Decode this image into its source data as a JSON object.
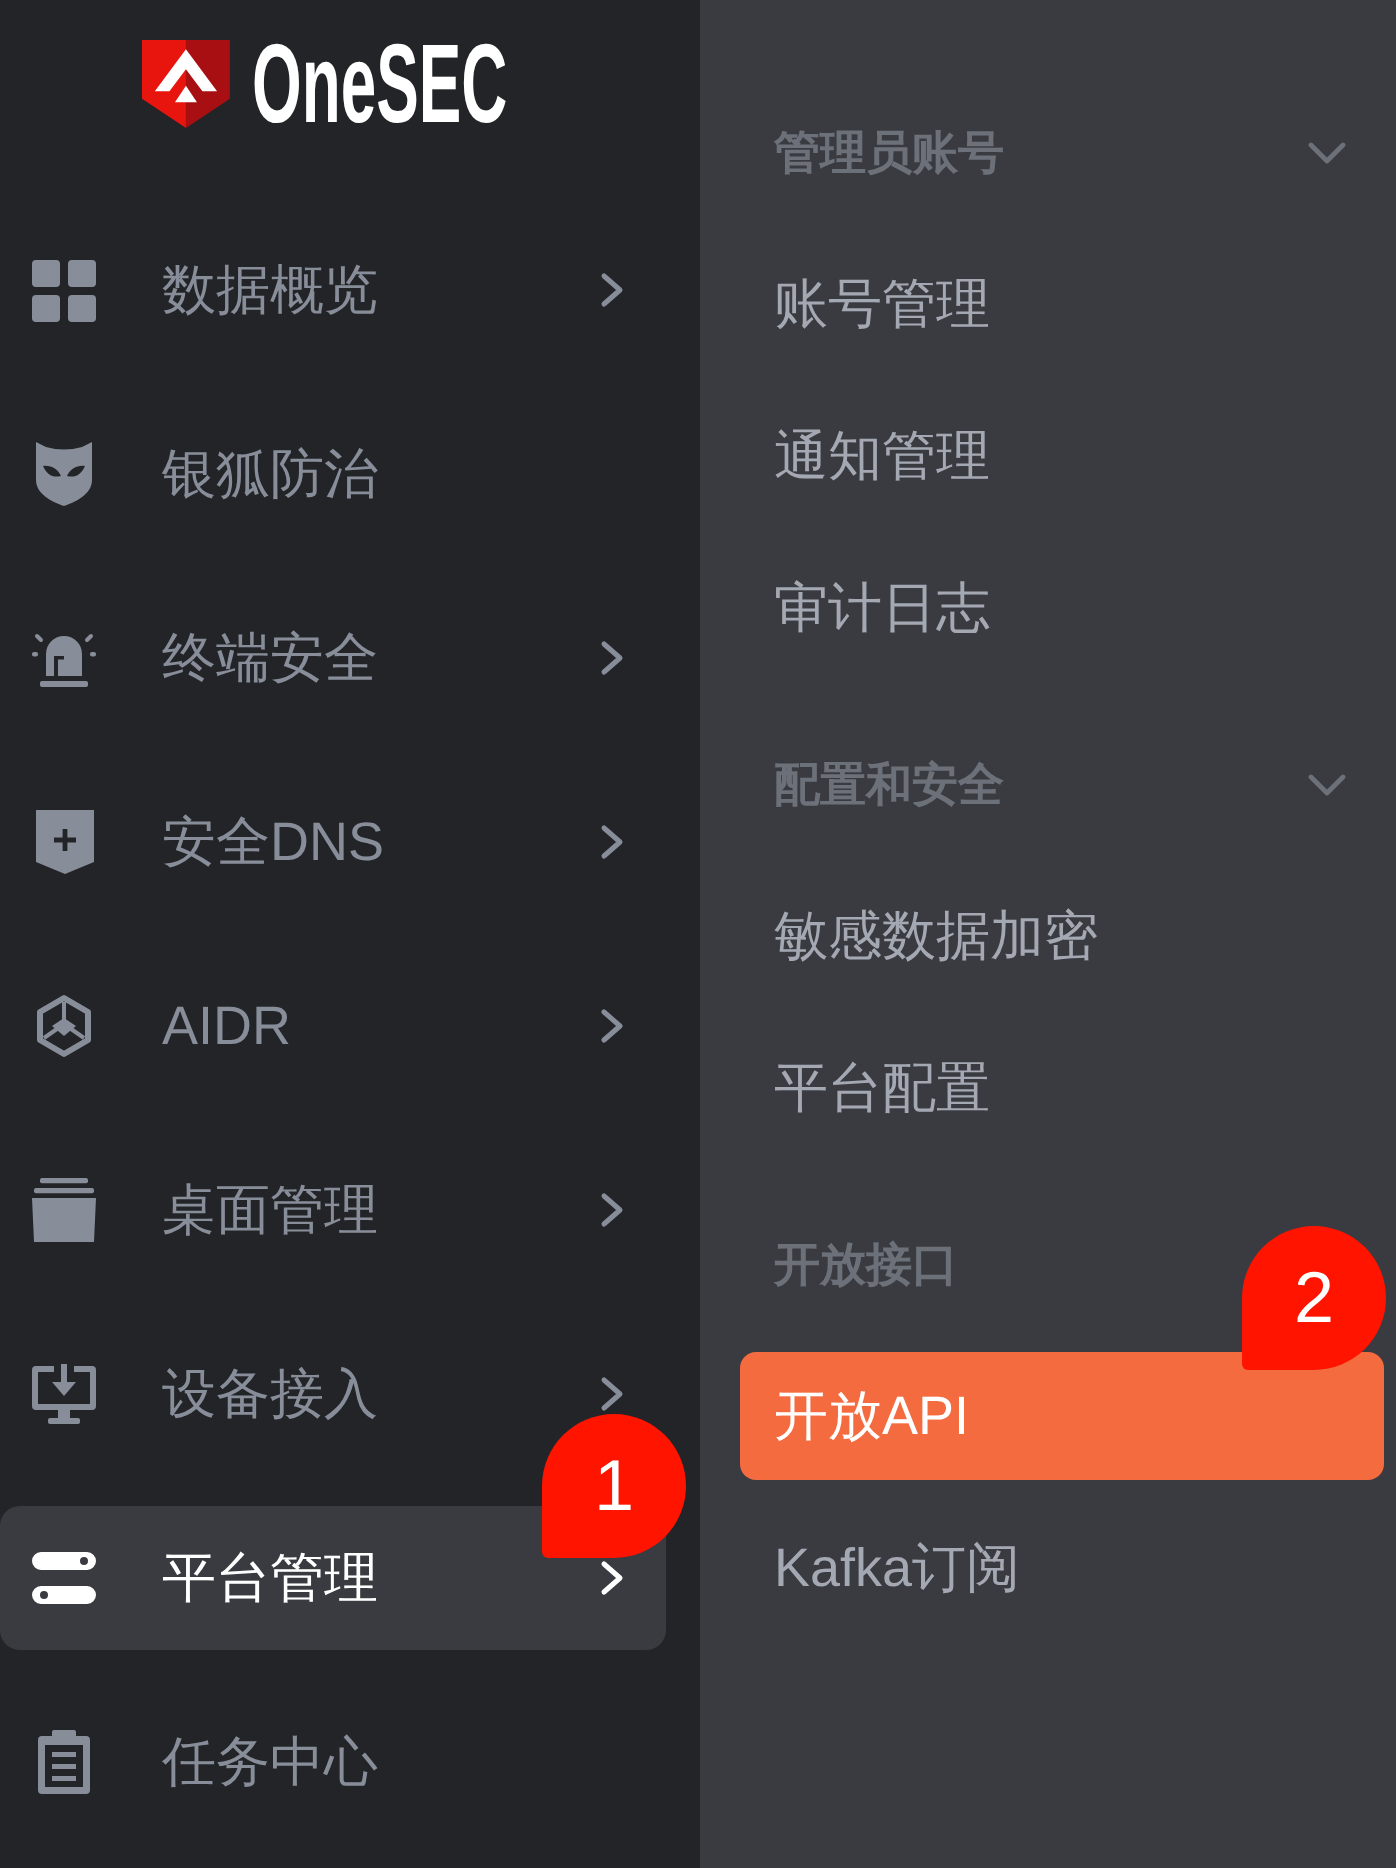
{
  "logo": {
    "text": "OneSEC"
  },
  "sidebar": {
    "items": [
      {
        "label": "数据概览",
        "has_submenu": true,
        "selected": false
      },
      {
        "label": "银狐防治",
        "has_submenu": false,
        "selected": false
      },
      {
        "label": "终端安全",
        "has_submenu": true,
        "selected": false
      },
      {
        "label": "安全DNS",
        "has_submenu": true,
        "selected": false
      },
      {
        "label": "AIDR",
        "has_submenu": true,
        "selected": false
      },
      {
        "label": "桌面管理",
        "has_submenu": true,
        "selected": false
      },
      {
        "label": "设备接入",
        "has_submenu": true,
        "selected": false
      },
      {
        "label": "平台管理",
        "has_submenu": true,
        "selected": true,
        "callout": "1"
      },
      {
        "label": "任务中心",
        "has_submenu": false,
        "selected": false
      }
    ]
  },
  "submenu": {
    "groups": [
      {
        "title": "管理员账号",
        "collapsible": true,
        "expanded": true,
        "items": [
          {
            "label": "账号管理",
            "selected": false
          },
          {
            "label": "通知管理",
            "selected": false
          },
          {
            "label": "审计日志",
            "selected": false
          }
        ]
      },
      {
        "title": "配置和安全",
        "collapsible": true,
        "expanded": true,
        "items": [
          {
            "label": "敏感数据加密",
            "selected": false
          },
          {
            "label": "平台配置",
            "selected": false
          }
        ]
      },
      {
        "title": "开放接口",
        "collapsible": false,
        "items": [
          {
            "label": "开放API",
            "selected": true,
            "callout": "2"
          },
          {
            "label": "Kafka订阅",
            "selected": false
          }
        ]
      }
    ]
  }
}
